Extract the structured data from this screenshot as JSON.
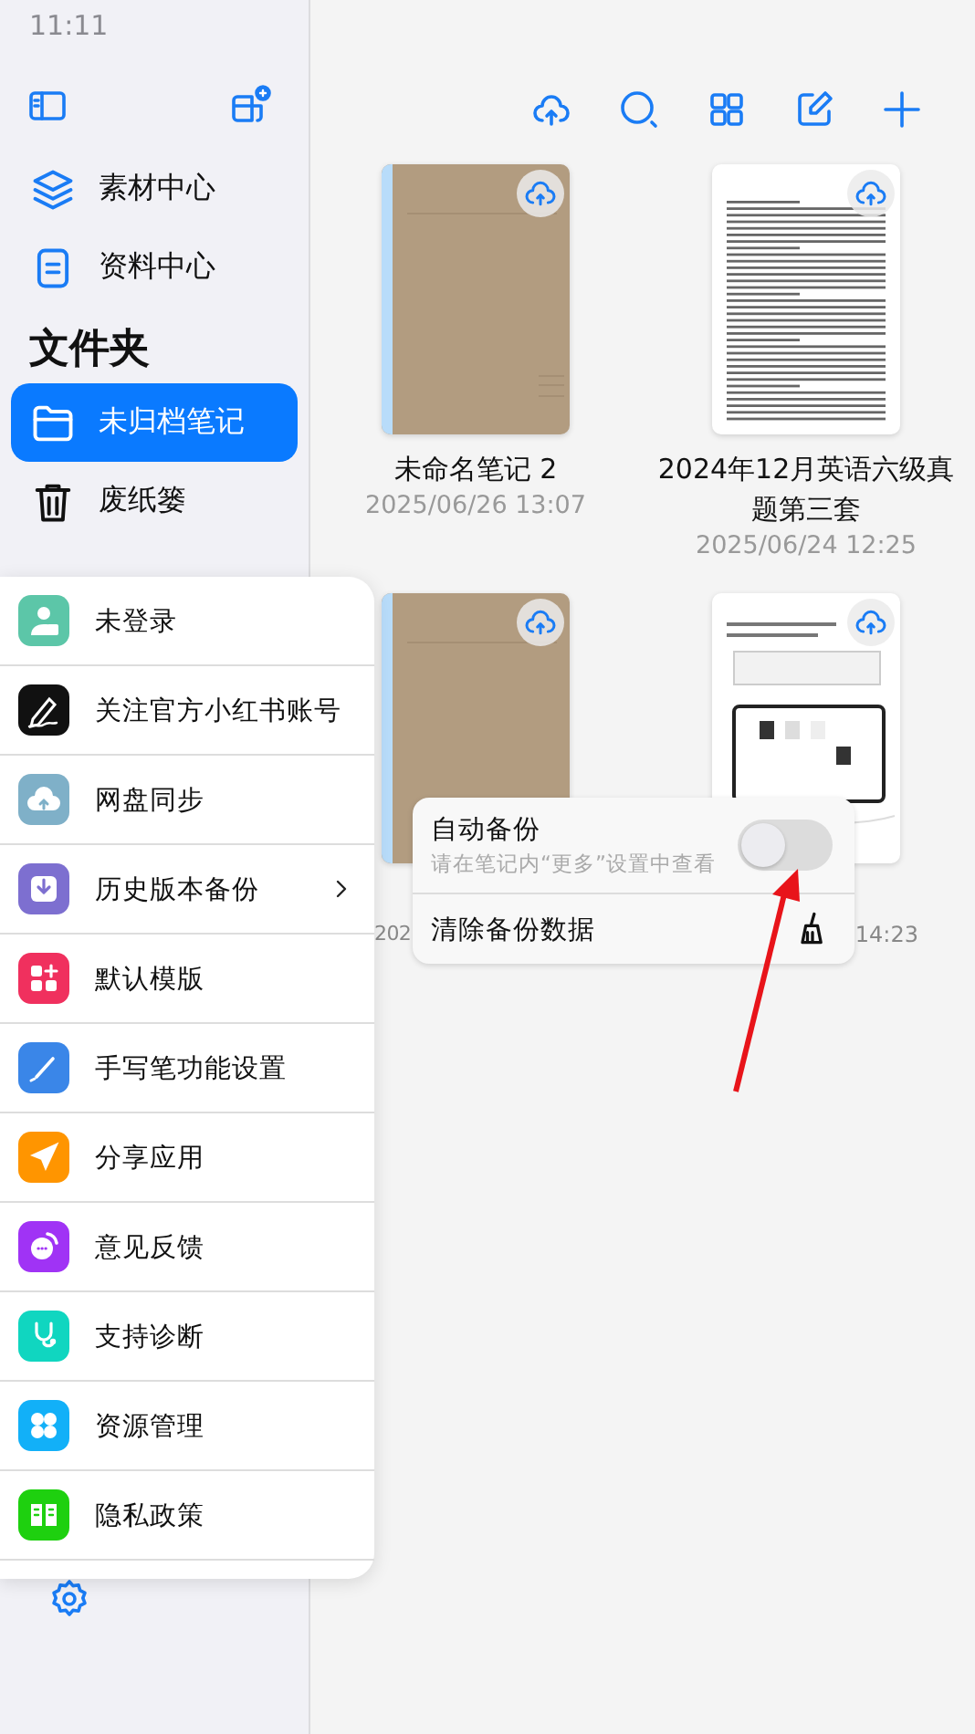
{
  "status_bar": {
    "time": "11:11"
  },
  "sidebar": {
    "items": [
      {
        "label": "素材中心"
      },
      {
        "label": "资料中心"
      }
    ],
    "folder_header": "文件夹",
    "folders": [
      {
        "label": "未归档笔记",
        "selected": true
      },
      {
        "label": "废纸篓",
        "selected": false
      }
    ]
  },
  "menu": {
    "items": [
      {
        "label": "未登录",
        "color": "#5cc6a8",
        "submenu": false
      },
      {
        "label": "关注官方小红书账号",
        "color": "#111111",
        "submenu": false
      },
      {
        "label": "网盘同步",
        "color": "#7fb0c8",
        "submenu": false
      },
      {
        "label": "历史版本备份",
        "color": "#7d6fd0",
        "submenu": true
      },
      {
        "label": "默认模版",
        "color": "#f0305e",
        "submenu": false
      },
      {
        "label": "手写笔功能设置",
        "color": "#3a86e8",
        "submenu": false
      },
      {
        "label": "分享应用",
        "color": "#ff9500",
        "submenu": false
      },
      {
        "label": "意见反馈",
        "color": "#a033f5",
        "submenu": false
      },
      {
        "label": "支持诊断",
        "color": "#10d6c0",
        "submenu": false
      },
      {
        "label": "资源管理",
        "color": "#12b0f8",
        "submenu": false
      },
      {
        "label": "隐私政策",
        "color": "#1ed00f",
        "submenu": false
      }
    ]
  },
  "notes": [
    {
      "kind": "notebook",
      "title": "未命名笔记 2",
      "date": "2025/06/26 13:07",
      "covered": false
    },
    {
      "kind": "document",
      "title": "2024年12月英语六级真题第三套",
      "date": "2025/06/24 12:25",
      "covered": false
    },
    {
      "kind": "notebook",
      "date": "202",
      "covered": true
    },
    {
      "kind": "screenshot",
      "date": "14:23",
      "covered": true
    }
  ],
  "popover": {
    "items": [
      {
        "kind": "toggle",
        "label": "自动备份",
        "hint": "请在笔记内“更多”设置中查看",
        "on": false
      },
      {
        "kind": "action",
        "label": "清除备份数据"
      }
    ]
  }
}
